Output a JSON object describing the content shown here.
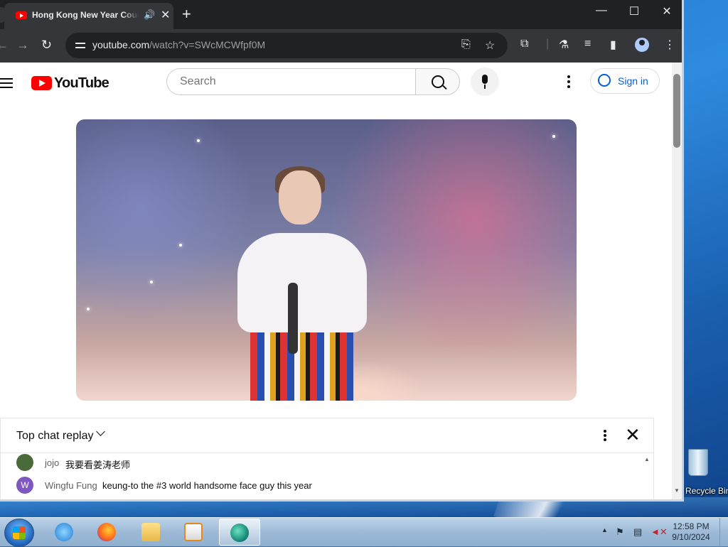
{
  "browser": {
    "tab_title": "Hong Kong New Year Countdown",
    "url_host": "youtube.com",
    "url_path": "/watch?v=SWcMCWfpf0M",
    "icons": {
      "audio": "speaker-icon",
      "close": "close-icon",
      "new_tab": "plus-icon",
      "back": "back-arrow-icon",
      "forward": "forward-arrow-icon",
      "reload": "reload-icon",
      "install": "install-app-icon",
      "bookmark": "star-icon",
      "extensions": "puzzle-icon",
      "labs": "flask-icon",
      "media": "media-controls-icon",
      "side_panel": "side-panel-icon",
      "profile": "profile-icon",
      "menu": "kebab-menu-icon"
    }
  },
  "youtube": {
    "logo_text": "YouTube",
    "search_placeholder": "Search",
    "sign_in_label": "Sign in"
  },
  "chat": {
    "title": "Top chat replay",
    "messages": [
      {
        "author": "jojo",
        "text": "我要看姜涛老师",
        "avatar_color": "#4a6a3a",
        "avatar_letter": ""
      },
      {
        "author": "Wingfu Fung",
        "text": "keung-to the #3 world handsome face guy this year",
        "avatar_color": "#7e57c2",
        "avatar_letter": "W"
      }
    ]
  },
  "desktop": {
    "recycle_bin_label": "Recycle Bin"
  },
  "taskbar": {
    "time": "12:58 PM",
    "date": "9/10/2024",
    "apps": [
      "internet-explorer-icon",
      "firefox-icon",
      "file-explorer-icon",
      "media-player-icon",
      "edge-browser-icon"
    ]
  },
  "colors": {
    "accent": "#065fd4",
    "youtube_red": "#ff0000",
    "chrome_dark": "#202124"
  }
}
